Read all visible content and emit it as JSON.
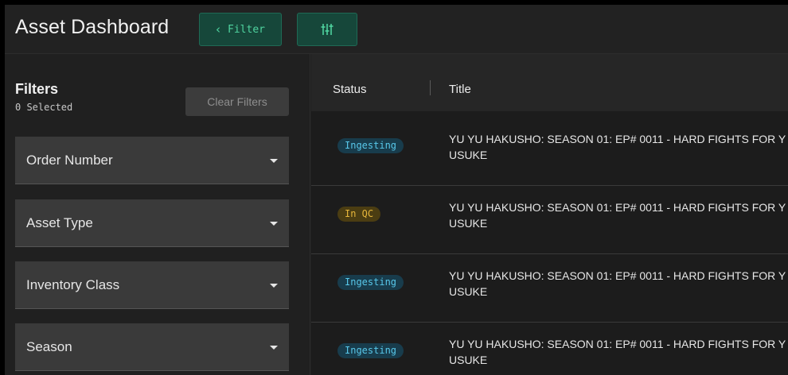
{
  "header": {
    "title": "Asset Dashboard",
    "filter_button_label": "Filter",
    "filter_button_icon": "chevron-left-icon",
    "tune_button_icon": "sliders-icon"
  },
  "sidebar": {
    "title": "Filters",
    "selected_count": "0 Selected",
    "clear_button_label": "Clear Filters",
    "dropdowns": [
      {
        "label": "Order Number"
      },
      {
        "label": "Asset Type"
      },
      {
        "label": "Inventory Class"
      },
      {
        "label": "Season"
      }
    ]
  },
  "table": {
    "columns": [
      "Status",
      "Title"
    ],
    "rows": [
      {
        "status": "Ingesting",
        "title": "YU YU HAKUSHO: SEASON 01: EP# 0011 - HARD FIGHTS FOR YUSUKE"
      },
      {
        "status": "In QC",
        "title": "YU YU HAKUSHO: SEASON 01: EP# 0011 - HARD FIGHTS FOR YUSUKE"
      },
      {
        "status": "Ingesting",
        "title": "YU YU HAKUSHO: SEASON 01: EP# 0011 - HARD FIGHTS FOR YUSUKE"
      },
      {
        "status": "Ingesting",
        "title": "YU YU HAKUSHO: SEASON 01: EP# 0011 - HARD FIGHTS FOR YUSUKE"
      }
    ]
  },
  "colors": {
    "accent_green": "#4fd39f",
    "status_ingesting": "#58c8ea",
    "status_in_qc": "#e6b63b"
  }
}
